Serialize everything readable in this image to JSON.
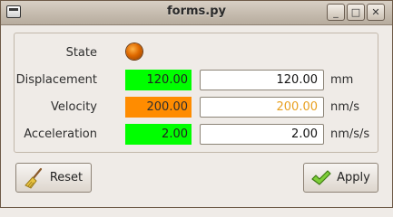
{
  "window": {
    "title": "forms.py",
    "minimize_glyph": "_",
    "maximize_glyph": "□",
    "close_glyph": "✕"
  },
  "form": {
    "state": {
      "label": "State",
      "led_color": "#e06a00"
    },
    "displacement": {
      "label": "Displacement",
      "value": "120.00",
      "entry": "120.00",
      "unit": "mm",
      "status_color": "#00ff00",
      "entry_text_color": "#111111"
    },
    "velocity": {
      "label": "Velocity",
      "value": "200.00",
      "entry": "200.00",
      "unit": "nm/s",
      "status_color": "#ff8c00",
      "entry_text_color": "#e8a020"
    },
    "acceleration": {
      "label": "Acceleration",
      "value": "2.00",
      "entry": "2.00",
      "unit": "nm/s/s",
      "status_color": "#00ff00",
      "entry_text_color": "#111111"
    }
  },
  "buttons": {
    "reset": {
      "label": "Reset",
      "icon": "broom-icon"
    },
    "apply": {
      "label": "Apply",
      "icon": "checkmark-icon"
    }
  }
}
